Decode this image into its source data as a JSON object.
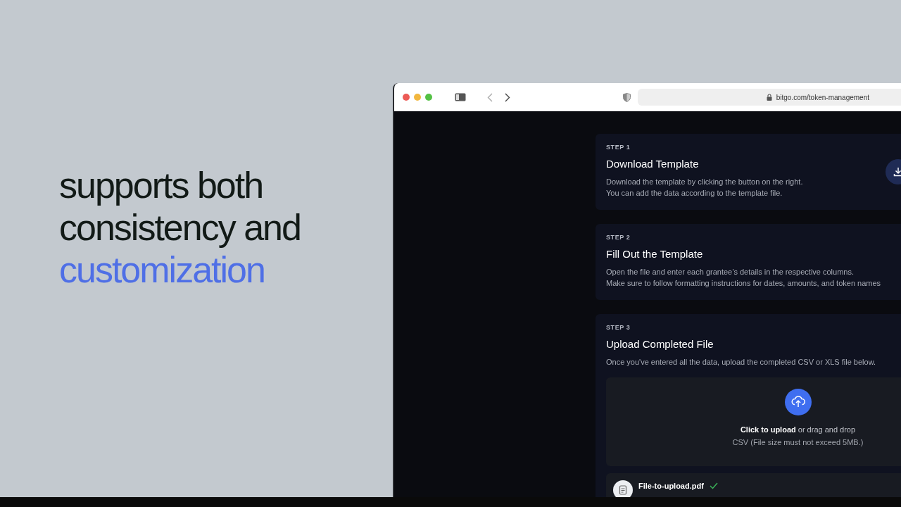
{
  "headline": [
    {
      "text": "supports both",
      "highlighted": false
    },
    {
      "text": "consistency and",
      "highlighted": false
    },
    {
      "text": "customization",
      "highlighted": true
    }
  ],
  "browser": {
    "address": "bitgo.com/token-management"
  },
  "steps": [
    {
      "step": "STEP 1",
      "title": "Download Template",
      "lines": [
        "Download the template by clicking the button on the right.",
        "You can add the data according to the template file."
      ],
      "kind": "download"
    },
    {
      "step": "STEP 2",
      "title": "Fill Out the Template",
      "lines": [
        "Open the file and enter each grantee’s details in the respective columns.",
        "Make sure to follow formatting instructions for dates, amounts, and token names"
      ],
      "kind": "text"
    },
    {
      "step": "STEP 3",
      "title": "Upload Completed File",
      "lines": [
        "Once you've entered all the data, upload the completed CSV or XLS file below."
      ],
      "kind": "upload"
    }
  ],
  "upload": {
    "prompt": "**Click to upload** or drag and drop",
    "hint": "CSV (File size must not exceed 5MB.)"
  },
  "file": {
    "name": "File-to-upload.pdf",
    "done": true
  }
}
